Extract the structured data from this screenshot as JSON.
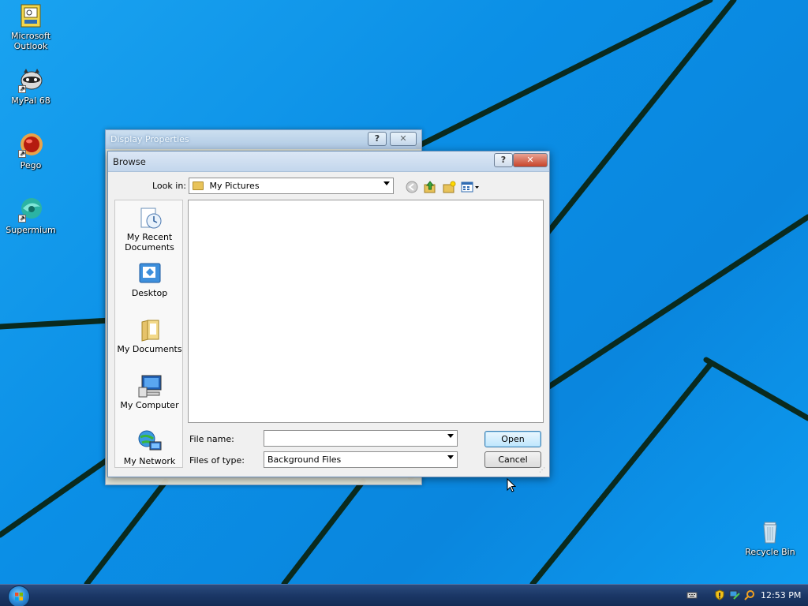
{
  "desktop": {
    "icons": [
      {
        "label": "Microsoft Outlook",
        "icon": "outlook-icon"
      },
      {
        "label": "MyPal 68",
        "icon": "mypal-icon"
      },
      {
        "label": "Pego",
        "icon": "pego-icon"
      },
      {
        "label": "Supermium",
        "icon": "supermium-icon"
      }
    ],
    "recycle_bin": {
      "label": "Recycle Bin",
      "icon": "recycle-bin-icon"
    }
  },
  "background_window": {
    "title": "Display Properties",
    "help": "?",
    "close": "✕"
  },
  "browse_dialog": {
    "title": "Browse",
    "help": "?",
    "close": "✕",
    "look_in_label": "Look in:",
    "look_in_value": "My Pictures",
    "toolbar": [
      "back-icon",
      "up-folder-icon",
      "new-folder-icon",
      "view-menu-icon"
    ],
    "places": [
      {
        "label": "My Recent Documents",
        "icon": "recent-documents-icon"
      },
      {
        "label": "Desktop",
        "icon": "desktop-icon"
      },
      {
        "label": "My Documents",
        "icon": "my-documents-icon"
      },
      {
        "label": "My Computer",
        "icon": "my-computer-icon"
      },
      {
        "label": "My Network",
        "icon": "my-network-icon"
      }
    ],
    "file_name_label": "File name:",
    "file_name_value": "",
    "files_of_type_label": "Files of type:",
    "files_of_type_value": "Background Files",
    "open_button": "Open",
    "cancel_button": "Cancel"
  },
  "taskbar": {
    "start": "start-orb-icon",
    "tray_icons": [
      "keyboard-icon",
      "security-shield-icon",
      "network-icon",
      "search-icon"
    ],
    "clock": "12:53 PM"
  },
  "colors": {
    "desktop": "#0f8fe8",
    "taskbar": "#1b3766",
    "dialog": "#f0f0f0"
  }
}
